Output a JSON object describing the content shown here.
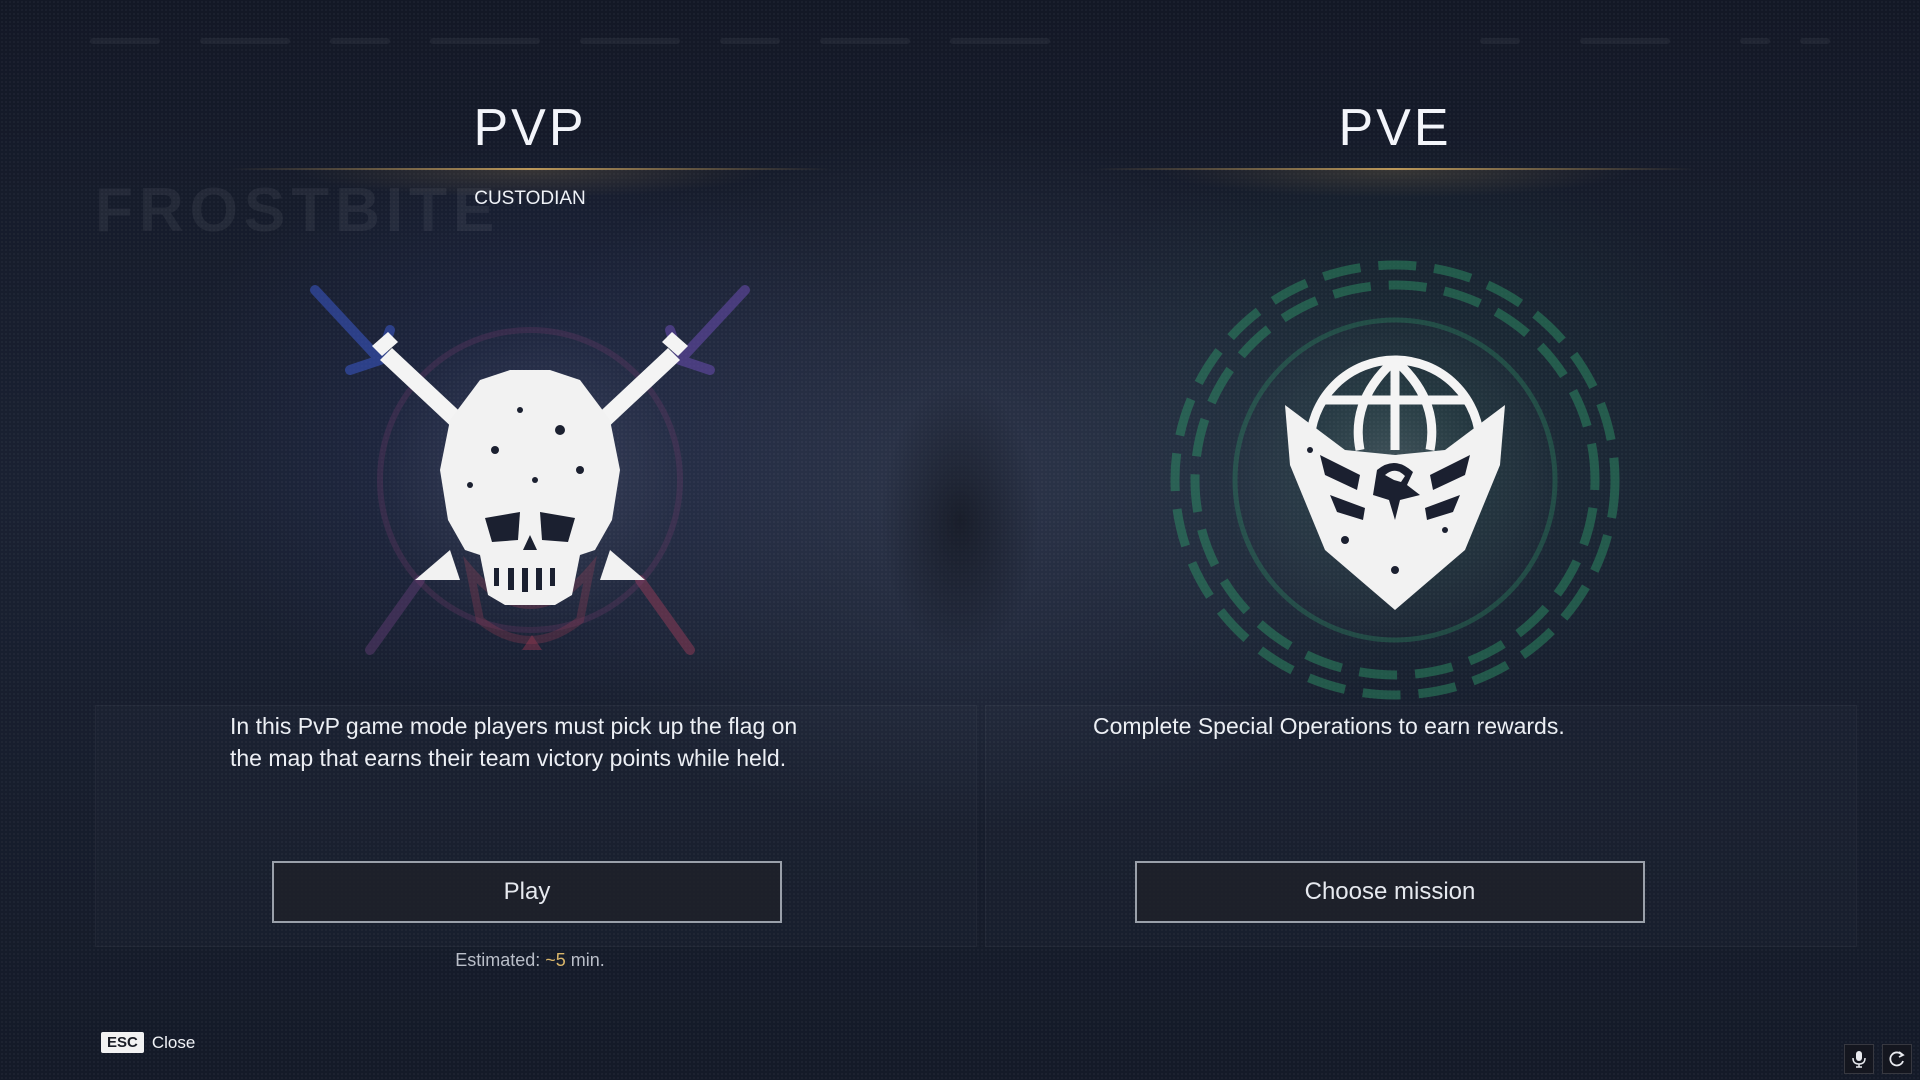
{
  "pvp": {
    "heading": "PVP",
    "mode_name": "CUSTODIAN",
    "emblem_icon": "skull-crossed-swords-icon",
    "description": "In this PvP game mode players must pick up the flag on the map that earns their team victory points while held.",
    "button_label": "Play",
    "estimate_prefix": "Estimated: ",
    "estimate_value": "~5",
    "estimate_suffix": " min."
  },
  "pve": {
    "heading": "PVE",
    "emblem_icon": "globe-eagle-icon",
    "description": "Complete Special Operations to earn rewards.",
    "button_label": "Choose mission"
  },
  "footer": {
    "esc_key": "ESC",
    "close_label": "Close",
    "mic_icon": "microphone-icon",
    "refresh_icon": "refresh-icon"
  },
  "colors": {
    "accent_gold": "#d8b56a",
    "pvp_glow_blue": "#3a57c8",
    "pvp_glow_red": "#9a3850",
    "pve_glow_green": "#2f9a6a"
  }
}
